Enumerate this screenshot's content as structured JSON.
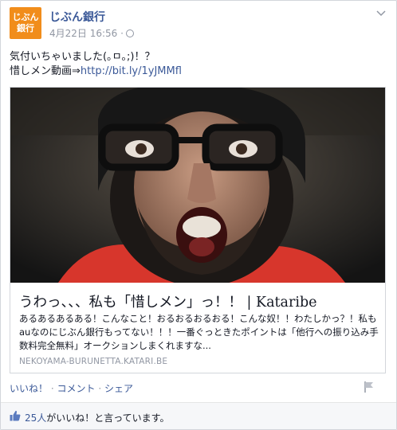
{
  "post": {
    "page_name": "じぶん銀行",
    "avatar_line1": "じぶん",
    "avatar_line2": "銀行",
    "timestamp": "4月22日 16:56",
    "meta_separator": "·",
    "text_line1": "気付いちゃいました(｡ㅁ｡;)！？",
    "text_line2_prefix": "惜しメン動画⇒",
    "link": "http://bit.ly/1yJMMfl"
  },
  "share": {
    "title": "うわっ、、、私も「惜しメン」っ！！ | Kataribe",
    "description": "あるあるあるある！こんなこと！おるおるおるおる！こんな奴！！わたしかっ？！私もauなのにじぶん銀行もってない！！！一番ぐっときたポイントは「他行への振り込み手数料完全無料」オークションしまくれますな...",
    "domain": "NEKOYAMA-BURUNETTA.KATARI.BE"
  },
  "actions": {
    "like": "いいね！",
    "comment": "コメント",
    "share": "シェア",
    "separator": "·"
  },
  "likes": {
    "count": "25人",
    "text": "がいいね！と言っています。"
  },
  "colors": {
    "link": "#3b5998",
    "avatar": "#f18d1b",
    "muted": "#9197a3"
  }
}
